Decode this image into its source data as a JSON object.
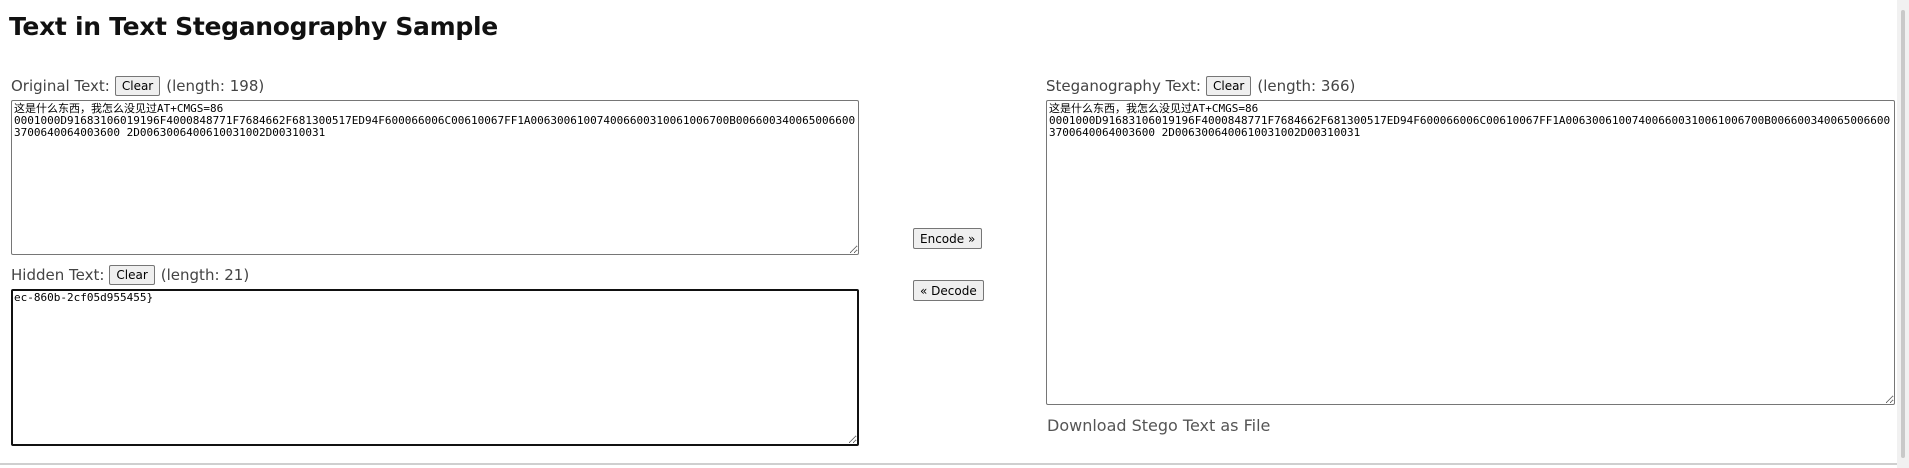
{
  "page": {
    "title": "Text in Text Steganography Sample"
  },
  "original": {
    "label": "Original Text:",
    "clear_label": "Clear",
    "length_text": "(length: 198)",
    "value": "这是什么东西，我怎么没见过AT+CMGS=86\n0001000D91683106019196F4000848771F7684662F681300517ED94F600066006C00610067FF1A006300610074006600310061006700B0066003400650066003700640064003600 2D0063006400610031002D00310031"
  },
  "hidden": {
    "label": "Hidden Text:",
    "clear_label": "Clear",
    "length_text": "(length: 21)",
    "value": "ec-860b-2cf05d955455}"
  },
  "actions": {
    "encode_label": "Encode »",
    "decode_label": "« Decode"
  },
  "stego": {
    "label": "Steganography Text:",
    "clear_label": "Clear",
    "length_text": "(length: 366)",
    "value": "这是什么东西，我怎么没见过AT+CMGS=86\n0001000D91683106019196F4000848771F7684662F681300517ED94F600066006C00610067FF1A006300610074006600310061006700B0066003400650066003700640064003600 2D0063006400610031002D00310031",
    "download_label": "Download Stego Text as File"
  }
}
